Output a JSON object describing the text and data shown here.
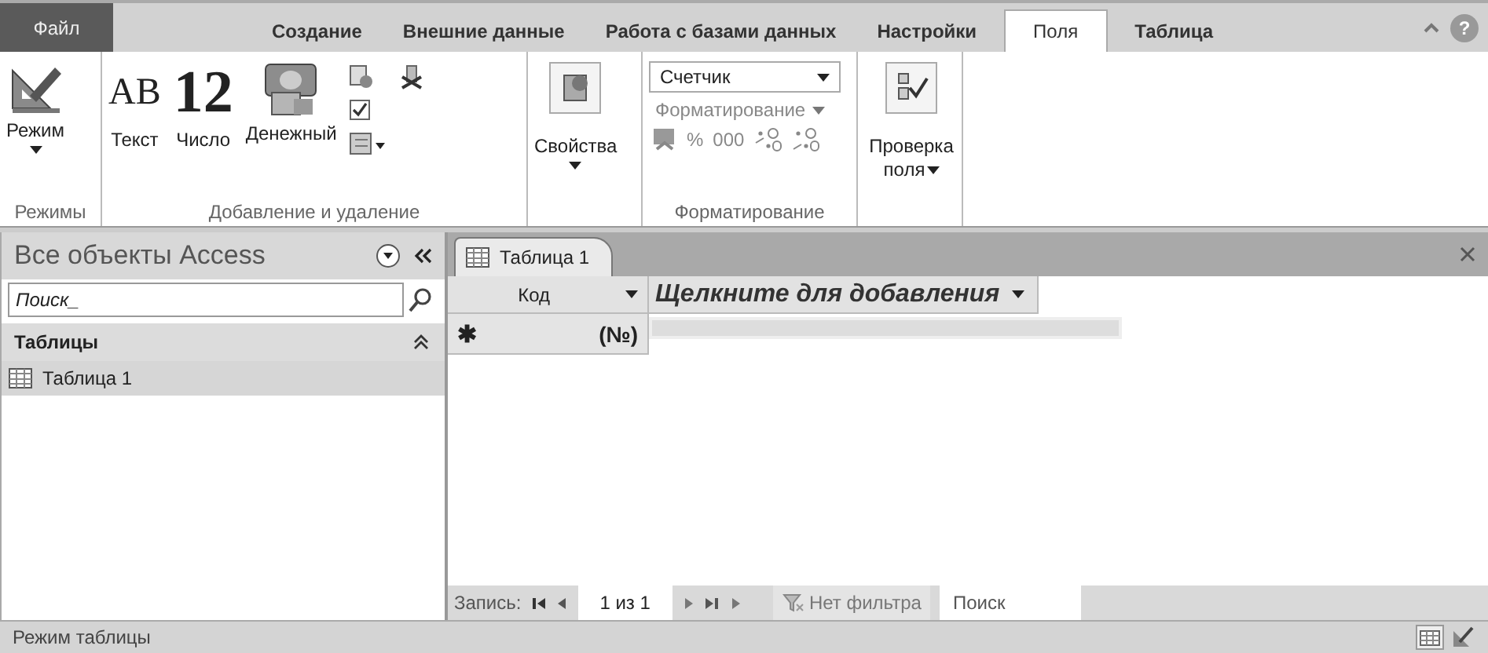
{
  "ribbon_tabs": [
    {
      "label": "Файл",
      "kind": "file",
      "selected": false
    },
    {
      "label": "Создание",
      "kind": "tab",
      "selected": false
    },
    {
      "label": "Внешние данные",
      "kind": "tab",
      "selected": false
    },
    {
      "label": "Работа с базами данных",
      "kind": "tab",
      "selected": false
    },
    {
      "label": "Настройки",
      "kind": "tab",
      "selected": false
    },
    {
      "label": "Поля",
      "kind": "tab",
      "selected": true
    },
    {
      "label": "Таблица",
      "kind": "tab",
      "selected": false
    }
  ],
  "help_button": "?",
  "ribbon": {
    "modes": {
      "button": "Режим",
      "group_label": "Режимы"
    },
    "add_delete": {
      "buttons": [
        {
          "glyph": "AB",
          "label": "Текст"
        },
        {
          "glyph": "12",
          "label": "Число"
        },
        {
          "label": "Денежный"
        }
      ],
      "group_label": "Добавление и удаление"
    },
    "properties": {
      "button": "Свойства"
    },
    "formatting": {
      "data_type": "Счетчик",
      "format": {
        "label": "Форматирование",
        "disabled": true
      },
      "number_buttons": [
        "%",
        "000"
      ],
      "group_label": "Форматирование"
    },
    "validation": {
      "button": "Проверка поля"
    }
  },
  "nav_pane": {
    "title": "Все объекты Access",
    "search_placeholder": "Поиск_",
    "sections": [
      {
        "title": "Таблицы",
        "expanded": true,
        "items": [
          {
            "label": "Таблица 1",
            "selected": true
          }
        ]
      }
    ]
  },
  "documents": [
    {
      "title": "Таблица 1",
      "selected": true
    }
  ],
  "datasheet": {
    "columns": [
      {
        "label": "Код",
        "kind": "field"
      },
      {
        "label": "Щелкните для добавления",
        "kind": "add"
      }
    ],
    "new_row": {
      "marker": "✱",
      "cells": [
        "(№)"
      ]
    }
  },
  "record_nav": {
    "label": "Запись:",
    "position": "1 из 1",
    "filter": {
      "label": "Нет фильтра",
      "disabled": true
    },
    "search_placeholder": "Поиск"
  },
  "status_bar": {
    "text": "Режим таблицы"
  }
}
